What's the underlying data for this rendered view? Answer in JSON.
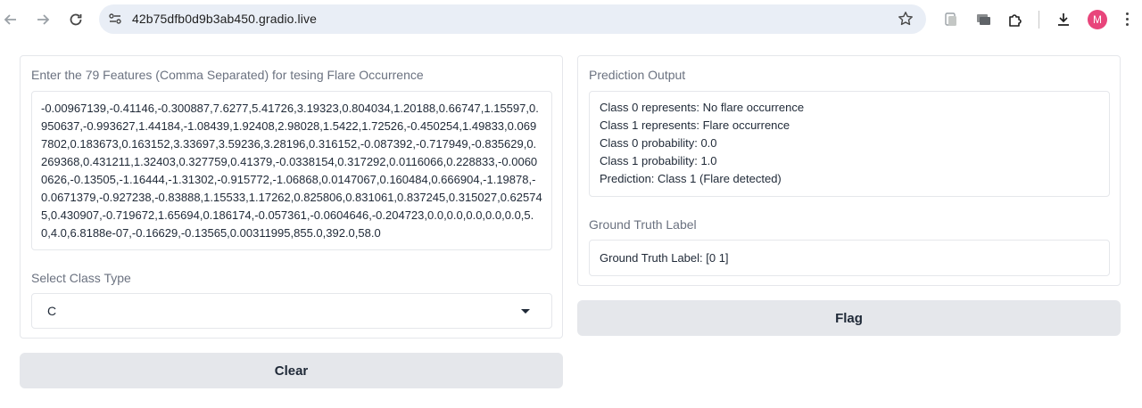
{
  "browser": {
    "url": "42b75dfb0d9b3ab450.gradio.live",
    "profile_initial": "M",
    "icons": [
      "back-icon",
      "forward-icon",
      "reload-icon",
      "site-info-icon",
      "star-icon",
      "tab-search-icon",
      "cast-icon",
      "extensions-icon",
      "download-icon",
      "menu-icon"
    ]
  },
  "inputs": {
    "features_label": "Enter the 79 Features (Comma Separated) for tesing Flare Occurrence",
    "features_value": "-0.00967139,-0.41146,-0.300887,7.6277,5.41726,3.19323,0.804034,1.20188,0.66747,1.15597,0.950637,-0.993627,1.44184,-1.08439,1.92408,2.98028,1.5422,1.72526,-0.450254,1.49833,0.0697802,0.183673,0.163152,3.33697,3.59236,3.28196,0.316152,-0.087392,-0.717949,-0.835629,0.269368,0.431211,1.32403,0.327759,0.41379,-0.0338154,0.317292,0.0116066,0.228833,-0.00600626,-0.13505,-1.16444,-1.31302,-0.915772,-1.06868,0.0147067,0.160484,0.666904,-1.19878,-0.0671379,-0.927238,-0.83888,1.15533,1.17262,0.825806,0.831061,0.837245,0.315027,0.625745,0.430907,-0.719672,1.65694,0.186174,-0.057361,-0.0604646,-0.204723,0.0,0.0,0.0,0.0,0.0,5.0,4.0,6.8188e-07,-0.16629,-0.13565,0.00311995,855.0,392.0,58.0",
    "class_label": "Select Class Type",
    "class_value": "C",
    "clear_label": "Clear"
  },
  "outputs": {
    "prediction_label": "Prediction Output",
    "prediction_lines": [
      "Class 0 represents: No flare occurrence",
      "Class 1 represents: Flare occurrence",
      "Class 0 probability: 0.0",
      "Class 1 probability: 1.0",
      "Prediction: Class 1 (Flare detected)"
    ],
    "ground_truth_label": "Ground Truth Label",
    "ground_truth_value": "Ground Truth Label: [0 1]",
    "flag_label": "Flag"
  }
}
